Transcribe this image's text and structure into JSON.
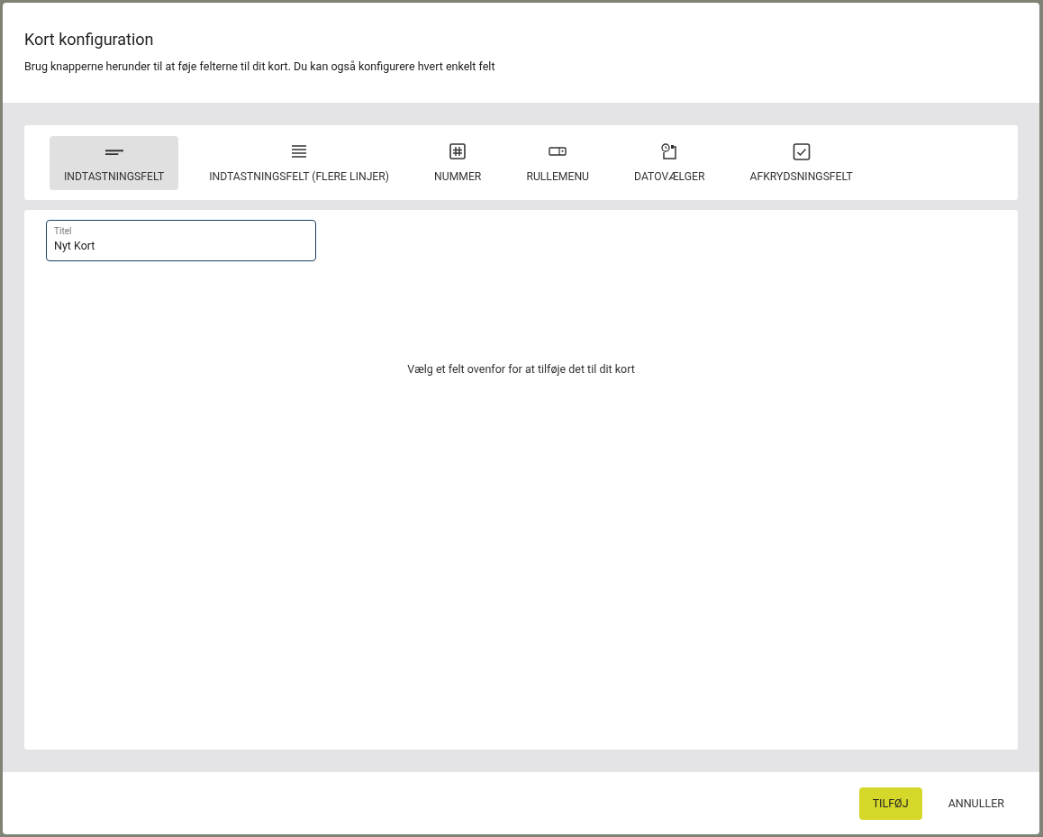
{
  "dialog": {
    "title": "Kort konfiguration",
    "description": "Brug knapperne herunder til at føje felterne til dit kort. Du kan også konfigurere hvert enkelt felt"
  },
  "field_types": [
    {
      "kind": "text",
      "label": "INDTASTNINGSFELT",
      "selected": true
    },
    {
      "kind": "multiline",
      "label": "INDTASTNINGSFELT (FLERE LINJER)",
      "selected": false
    },
    {
      "kind": "number",
      "label": "NUMMER",
      "selected": false
    },
    {
      "kind": "dropdown",
      "label": "RULLEMENU",
      "selected": false
    },
    {
      "kind": "date",
      "label": "DATOVÆLGER",
      "selected": false
    },
    {
      "kind": "checkbox",
      "label": "AFKRYDSNINGSFELT",
      "selected": false
    }
  ],
  "title_field": {
    "label": "Titel",
    "value": "Nyt Kort"
  },
  "empty_message": "Vælg et felt ovenfor for at tilføje det til dit kort",
  "buttons": [
    {
      "kind": "primary",
      "label": "TILFØJ"
    },
    {
      "kind": "text",
      "label": "ANNULLER"
    }
  ]
}
